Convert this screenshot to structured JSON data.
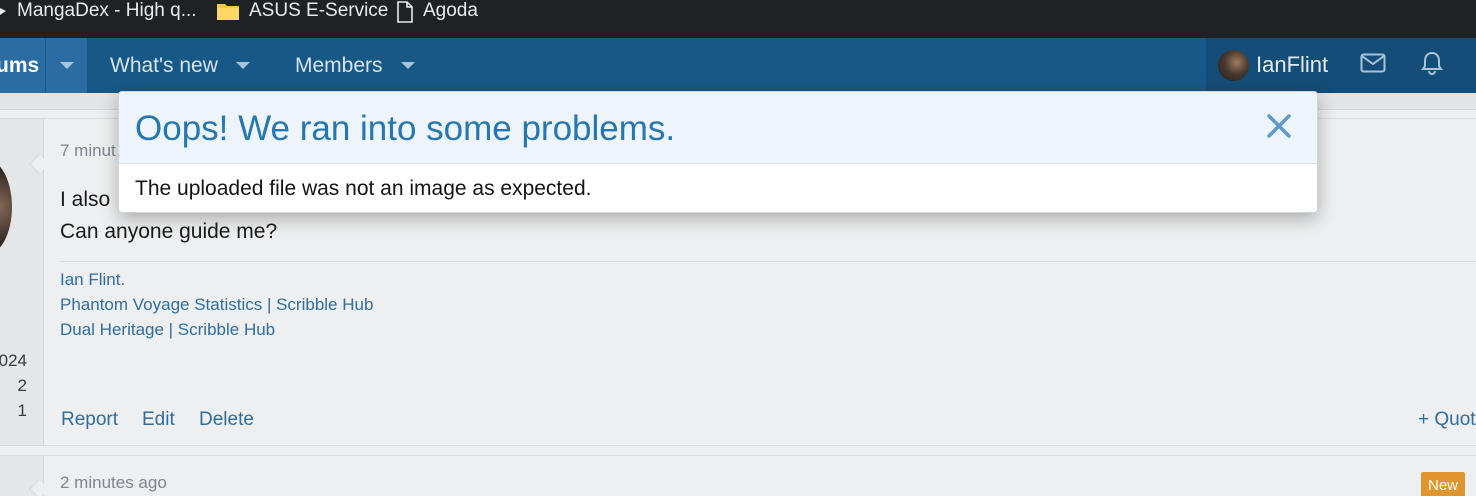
{
  "bookmarks_bar": {
    "items": [
      {
        "label": "MangaDex - High q...",
        "icon": "mangadex-icon"
      },
      {
        "label": "ASUS E-Service",
        "icon": "folder-icon"
      },
      {
        "label": "Agoda",
        "icon": "page-icon"
      }
    ]
  },
  "forum_nav": {
    "forums_label": "ums",
    "items": [
      {
        "label": "What's new"
      },
      {
        "label": "Members"
      }
    ],
    "username": "IanFlint",
    "icons": [
      "avatar",
      "envelope-icon",
      "bell-icon"
    ]
  },
  "post": {
    "time": "7 minut",
    "body_line_1": "I also",
    "body_line_2": "Can anyone guide me?",
    "user_stats": [
      "024",
      "2",
      "1"
    ],
    "signature": [
      "Ian Flint.",
      "Phantom Voyage Statistics | Scribble Hub",
      "Dual Heritage | Scribble Hub"
    ],
    "actions": {
      "report": "Report",
      "edit": "Edit",
      "delete": "Delete",
      "quote": "+ Quot"
    }
  },
  "next_post": {
    "time": "2 minutes ago",
    "badge": "New"
  },
  "modal": {
    "title": "Oops! We ran into some problems.",
    "message": "The uploaded file was not an image as expected.",
    "close_icon": "close-icon"
  },
  "colors": {
    "nav_bg": "#185886",
    "modal_title": "#2577b1",
    "link": "#2f6d9e",
    "badge": "#e0952f"
  }
}
